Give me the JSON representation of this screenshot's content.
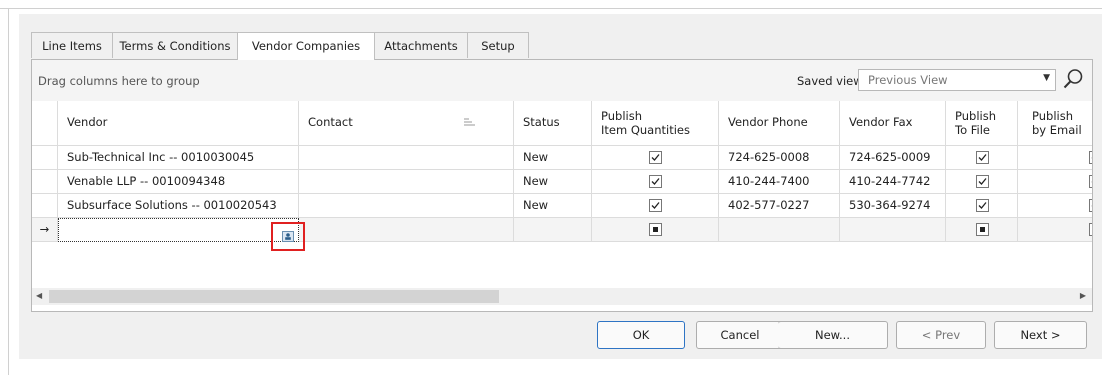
{
  "tabs": [
    {
      "label": "Line Items",
      "active": false
    },
    {
      "label": "Terms & Conditions",
      "active": false
    },
    {
      "label": "Vendor Companies",
      "active": true
    },
    {
      "label": "Attachments",
      "active": false
    },
    {
      "label": "Setup",
      "active": false
    }
  ],
  "grid": {
    "group_hint": "Drag columns here to group",
    "saved_views_label": "Saved views:",
    "saved_views_value": "Previous View",
    "columns": {
      "vendor": "Vendor",
      "contact": "Contact",
      "status": "Status",
      "publish_qty_line1": "Publish",
      "publish_qty_line2": "Item Quantities",
      "phone": "Vendor Phone",
      "fax": "Vendor Fax",
      "publish_file_line1": "Publish",
      "publish_file_line2": "To File",
      "publish_email_line1": "Publish",
      "publish_email_line2": "by Email"
    },
    "rows": [
      {
        "vendor": "Sub-Technical Inc -- 0010030045",
        "contact": "",
        "status": "New",
        "publish_qty": true,
        "phone": "724-625-0008",
        "fax": "724-625-0009",
        "publish_file": true,
        "publish_email": true
      },
      {
        "vendor": "Venable LLP -- 0010094348",
        "contact": "",
        "status": "New",
        "publish_qty": true,
        "phone": "410-244-7400",
        "fax": "410-244-7742",
        "publish_file": true,
        "publish_email": true
      },
      {
        "vendor": "Subsurface Solutions -- 0010020543",
        "contact": "",
        "status": "New",
        "publish_qty": true,
        "phone": "402-577-0227",
        "fax": "530-364-9274",
        "publish_file": true,
        "publish_email": true
      }
    ],
    "new_row_indicator": "→"
  },
  "buttons": {
    "ok": "OK",
    "cancel": "Cancel",
    "new": "New...",
    "prev": "< Prev",
    "next": "Next >"
  },
  "icons": {
    "search": "search-icon",
    "contact_picker": "contact-card-icon",
    "sort": "column-options-icon"
  },
  "colors": {
    "highlight": "#e02020",
    "default_button_border": "#2e74c4"
  }
}
